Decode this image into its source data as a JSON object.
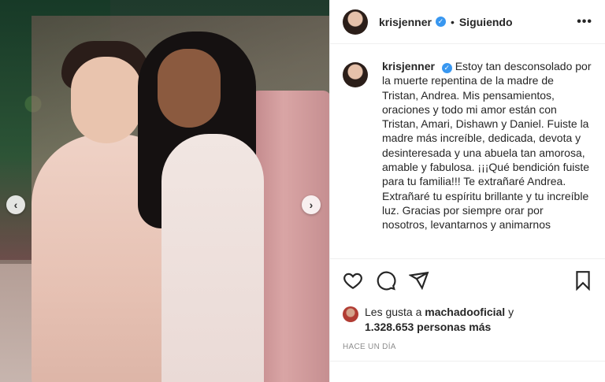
{
  "post": {
    "username": "krisjenner",
    "follow_status": "Siguiendo",
    "more_icon": "more-options-icon",
    "caption_text": "Estoy tan desconsolado por la muerte repentina de la madre de Tristan, Andrea. Mis pensamientos, oraciones y todo mi amor están con Tristan, Amari, Dishawn y Daniel. Fuiste la madre más increíble, dedicada, devota y desinteresada y una abuela tan amorosa, amable y fabulosa. ¡¡¡Qué bendición fuiste para tu familia!!! Te extrañaré Andrea. Extrañaré tu espíritu brillante y tu increíble luz. Gracias por siempre orar por nosotros, levantarnos y animarnos",
    "likes_prefix": "Les gusta a",
    "likes_user": "machadooficial",
    "likes_and": "y",
    "likes_count": "1.328.653 personas más",
    "timestamp": "HACE UN DÍA"
  },
  "icons": {
    "verified": "✓",
    "carousel_prev": "‹",
    "carousel_next": "›"
  },
  "colors": {
    "verified_blue": "#3897f0",
    "divider": "#efefef",
    "muted": "#8e8e8e"
  }
}
